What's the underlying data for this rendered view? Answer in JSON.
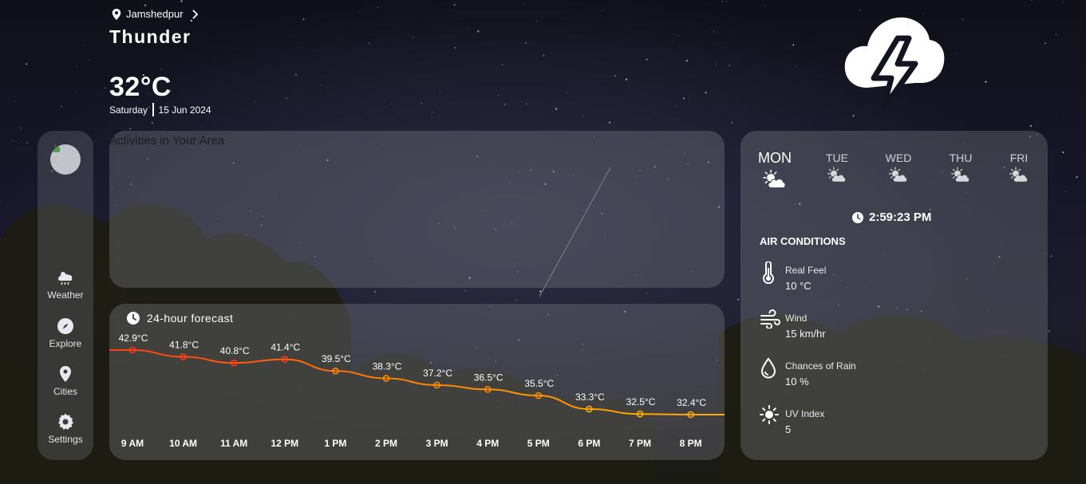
{
  "header": {
    "location": "Jamshedpur",
    "condition": "Thunder",
    "temperature": "32°C",
    "day": "Saturday",
    "date": "15 Jun 2024",
    "icon": "thunder-cloud-icon"
  },
  "sidebar": {
    "items": [
      {
        "label": "Weather",
        "icon": "cloud-rain-sun-icon"
      },
      {
        "label": "Explore",
        "icon": "compass-icon"
      },
      {
        "label": "Cities",
        "icon": "map-pin-icon"
      },
      {
        "label": "Settings",
        "icon": "gear-icon"
      }
    ]
  },
  "activities": {
    "title": "Activities in Your Area"
  },
  "forecast": {
    "title": "24-hour forecast",
    "icon": "clock-icon"
  },
  "chart_data": {
    "type": "line",
    "title": "24-hour forecast",
    "categories": [
      "9 AM",
      "10 AM",
      "11 AM",
      "12 PM",
      "1 PM",
      "2 PM",
      "3 PM",
      "4 PM",
      "5 PM",
      "6 PM",
      "7 PM",
      "8 PM"
    ],
    "values": [
      42.9,
      41.8,
      40.8,
      41.4,
      39.5,
      38.3,
      37.2,
      36.5,
      35.5,
      33.3,
      32.5,
      32.4
    ],
    "value_labels": [
      "42.9°C",
      "41.8°C",
      "40.8°C",
      "41.4°C",
      "39.5°C",
      "38.3°C",
      "37.2°C",
      "36.5°C",
      "35.5°C",
      "33.3°C",
      "32.5°C",
      "32.4°C"
    ],
    "colors": {
      "hot": "#ff3b1a",
      "warm": "#ff8a00",
      "mild": "#ffb000"
    },
    "grid": false,
    "legend": "none"
  },
  "week": {
    "days": [
      {
        "label": "MON",
        "icon": "partly-cloudy-sun-icon"
      },
      {
        "label": "TUE",
        "icon": "partly-cloudy-sun-icon"
      },
      {
        "label": "WED",
        "icon": "partly-cloudy-sun-icon"
      },
      {
        "label": "THU",
        "icon": "partly-cloudy-sun-icon"
      },
      {
        "label": "FRI",
        "icon": "partly-cloudy-sun-icon"
      }
    ]
  },
  "clock": {
    "time": "2:59:23 PM",
    "icon": "clock-icon"
  },
  "air": {
    "title": "AIR CONDITIONS",
    "items": [
      {
        "label": "Real Feel",
        "value": "10 °C",
        "icon": "thermometer-icon"
      },
      {
        "label": "Wind",
        "value": "15 km/hr",
        "icon": "wind-icon"
      },
      {
        "label": "Chances of Rain",
        "value": "10 %",
        "icon": "water-drop-icon"
      },
      {
        "label": "UV Index",
        "value": "5",
        "icon": "sun-icon"
      }
    ]
  }
}
